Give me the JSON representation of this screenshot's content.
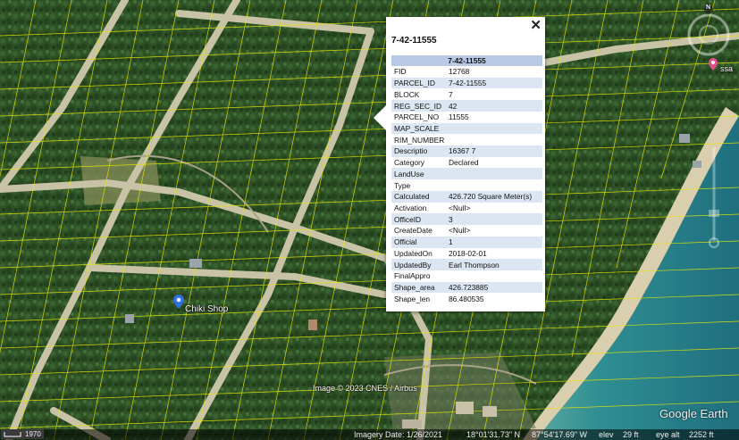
{
  "popup": {
    "title": "7-42-11555",
    "table_header": "7-42-11555",
    "close_icon": "close-icon",
    "rows": [
      {
        "key": "FID",
        "value": "12768"
      },
      {
        "key": "PARCEL_ID",
        "value": "7-42-11555"
      },
      {
        "key": "BLOCK",
        "value": "7"
      },
      {
        "key": "REG_SEC_ID",
        "value": "42"
      },
      {
        "key": "PARCEL_NO",
        "value": "11555"
      },
      {
        "key": "MAP_SCALE",
        "value": ""
      },
      {
        "key": "RIM_NUMBER",
        "value": ""
      },
      {
        "key": "Descriptio",
        "value": "16367 7"
      },
      {
        "key": "Category",
        "value": "Declared"
      },
      {
        "key": "LandUse",
        "value": ""
      },
      {
        "key": "Type",
        "value": ""
      },
      {
        "key": "Calculated",
        "value": "426.720 Square Meter(s)"
      },
      {
        "key": "Activation",
        "value": "<Null>"
      },
      {
        "key": "OfficeID",
        "value": "3"
      },
      {
        "key": "CreateDate",
        "value": "<Null>"
      },
      {
        "key": "Official",
        "value": "1"
      },
      {
        "key": "UpdatedOn",
        "value": "2018-02-01"
      },
      {
        "key": "UpdatedBy",
        "value": "Earl Thompson"
      },
      {
        "key": "FinalAppro",
        "value": ""
      },
      {
        "key": "Shape_area",
        "value": "426.723885"
      },
      {
        "key": "Shape_len",
        "value": "86.480535"
      }
    ]
  },
  "map": {
    "place_label": "Chiki Shop",
    "place_icon": "map-pin-icon",
    "poi_label": "ssa",
    "poi_icon": "pink-pin-icon",
    "attribution": "Image © 2023 CNES / Airbus",
    "brand": "Google Earth",
    "compass_letter": "N"
  },
  "status": {
    "scale": "1970",
    "imagery_date": "Imagery Date: 1/26/2021",
    "lat": "18°01'31.73\" N",
    "lon": "87°54'17.69\" W",
    "elev_label": "elev",
    "elev": "29 ft",
    "eye_alt_label": "eye alt",
    "eye_alt": "2252 ft"
  },
  "colors": {
    "parcel_lines": "#e6e600",
    "road": "#b9b49a",
    "water": "#2e8f8f",
    "header_row": "#b7c9e5",
    "alt_row": "#dce6f2"
  }
}
